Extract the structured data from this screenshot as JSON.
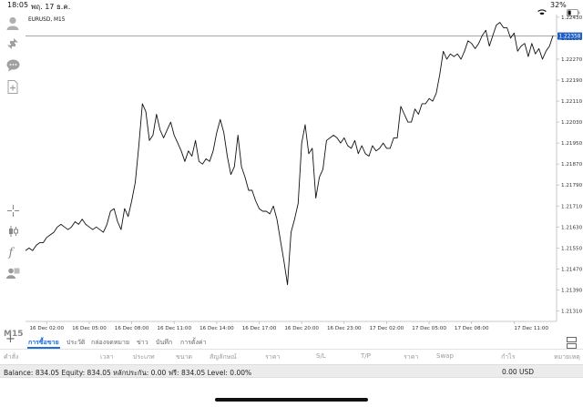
{
  "status_bar": {
    "time": "18:05",
    "date": "พฤ. 17 ธ.ค.",
    "battery_percent": "32%",
    "battery_level": 0.32,
    "icons": [
      "wifi-icon",
      "battery-icon"
    ]
  },
  "toolbar": {
    "icons": [
      "account-icon",
      "trade-arrows-icon",
      "chat-icon",
      "new-document-icon",
      "crosshair-icon",
      "candlestick-icon",
      "function-f-icon",
      "objects-icon"
    ],
    "timeframe": "M15"
  },
  "chart": {
    "symbol_label": "EURUSD, M15",
    "current_price_label": "1.22358",
    "line_color": "#111111",
    "bid_line_color": "#888888",
    "price_badge_color": "#1e5fc4"
  },
  "chart_data": {
    "type": "line",
    "title": "EURUSD, M15",
    "xlabel": "",
    "ylabel": "",
    "ylim": [
      1.2127,
      1.2244
    ],
    "y_ticks": [
      "1.22430",
      "1.22350",
      "1.22270",
      "1.22190",
      "1.22110",
      "1.22030",
      "1.21950",
      "1.21870",
      "1.21790",
      "1.21710",
      "1.21630",
      "1.21550",
      "1.21470",
      "1.21390",
      "1.21310"
    ],
    "y_tick_values": [
      1.2243,
      1.2235,
      1.2227,
      1.2219,
      1.2211,
      1.2203,
      1.2195,
      1.2187,
      1.2179,
      1.2171,
      1.2163,
      1.2155,
      1.2147,
      1.2139,
      1.2131
    ],
    "x_ticks": [
      "16 Dec 02:00",
      "16 Dec 05:00",
      "16 Dec 08:00",
      "16 Dec 11:00",
      "16 Dec 14:00",
      "16 Dec 17:00",
      "16 Dec 20:00",
      "16 Dec 23:00",
      "17 Dec 02:00",
      "17 Dec 05:00",
      "17 Dec 08:00",
      "17 Dec 11:00"
    ],
    "x_tick_index": [
      6,
      18,
      30,
      42,
      54,
      66,
      78,
      90,
      102,
      114,
      126,
      138
    ],
    "bid_price": 1.22358,
    "series": [
      {
        "values": [
          1.2154,
          1.2155,
          1.2154,
          1.2156,
          1.2157,
          1.2157,
          1.2159,
          1.216,
          1.2161,
          1.2163,
          1.2164,
          1.2163,
          1.2162,
          1.2163,
          1.2165,
          1.2164,
          1.2166,
          1.2164,
          1.2163,
          1.2162,
          1.2163,
          1.2162,
          1.2161,
          1.2164,
          1.2169,
          1.217,
          1.2165,
          1.2162,
          1.217,
          1.2167,
          1.2173,
          1.218,
          1.2194,
          1.221,
          1.2207,
          1.2196,
          1.2198,
          1.2206,
          1.22,
          1.2197,
          1.22,
          1.2203,
          1.2198,
          1.2195,
          1.2192,
          1.2188,
          1.2192,
          1.219,
          1.2196,
          1.2188,
          1.2187,
          1.2189,
          1.2188,
          1.2192,
          1.2199,
          1.2204,
          1.2199,
          1.219,
          1.2183,
          1.2186,
          1.2198,
          1.2186,
          1.2182,
          1.2177,
          1.2177,
          1.2173,
          1.217,
          1.2169,
          1.2169,
          1.2168,
          1.2171,
          1.2166,
          1.2158,
          1.215,
          1.2141,
          1.2161,
          1.2166,
          1.2172,
          1.2195,
          1.2202,
          1.2191,
          1.2193,
          1.2174,
          1.2182,
          1.2185,
          1.2196,
          1.2197,
          1.2198,
          1.2197,
          1.2195,
          1.2197,
          1.2194,
          1.2193,
          1.2196,
          1.2191,
          1.2194,
          1.2191,
          1.219,
          1.2194,
          1.2192,
          1.2193,
          1.2195,
          1.2193,
          1.2193,
          1.2197,
          1.2197,
          1.2209,
          1.2206,
          1.2203,
          1.2203,
          1.2208,
          1.2206,
          1.221,
          1.221,
          1.2212,
          1.2211,
          1.2214,
          1.2221,
          1.223,
          1.2227,
          1.2229,
          1.2228,
          1.2229,
          1.2227,
          1.223,
          1.2234,
          1.2233,
          1.2231,
          1.2233,
          1.2236,
          1.2238,
          1.2232,
          1.2236,
          1.224,
          1.2241,
          1.2239,
          1.2239,
          1.2235,
          1.2237,
          1.223,
          1.2232,
          1.2233,
          1.2228,
          1.2233,
          1.2229,
          1.2231,
          1.2227,
          1.223,
          1.2232,
          1.2236
        ]
      }
    ],
    "grid": false,
    "legend": "none"
  },
  "tabs": {
    "add_symbol": "+",
    "items": [
      {
        "label": "การซื้อขาย",
        "active": true
      },
      {
        "label": "ประวัติ",
        "active": false
      },
      {
        "label": "กล่องจดหมาย",
        "active": false
      },
      {
        "label": "ข่าว",
        "active": false
      },
      {
        "label": "บันทึก",
        "active": false
      },
      {
        "label": "การตั้งค่า",
        "active": false
      }
    ]
  },
  "columns": [
    "คำสั่ง",
    "เวลา",
    "ประเภท",
    "ขนาด",
    "สัญลักษณ์",
    "ราคา",
    "S/L",
    "T/P",
    "ราคา",
    "Swap",
    "กำไร",
    "หมายเหตุ"
  ],
  "balance": {
    "summary": "Balance: 834.05 Equity: 834.05 หลักประกัน: 0.00 ฟรี: 834.05 Level: 0.00%",
    "profit": "0.00",
    "currency": "USD"
  }
}
